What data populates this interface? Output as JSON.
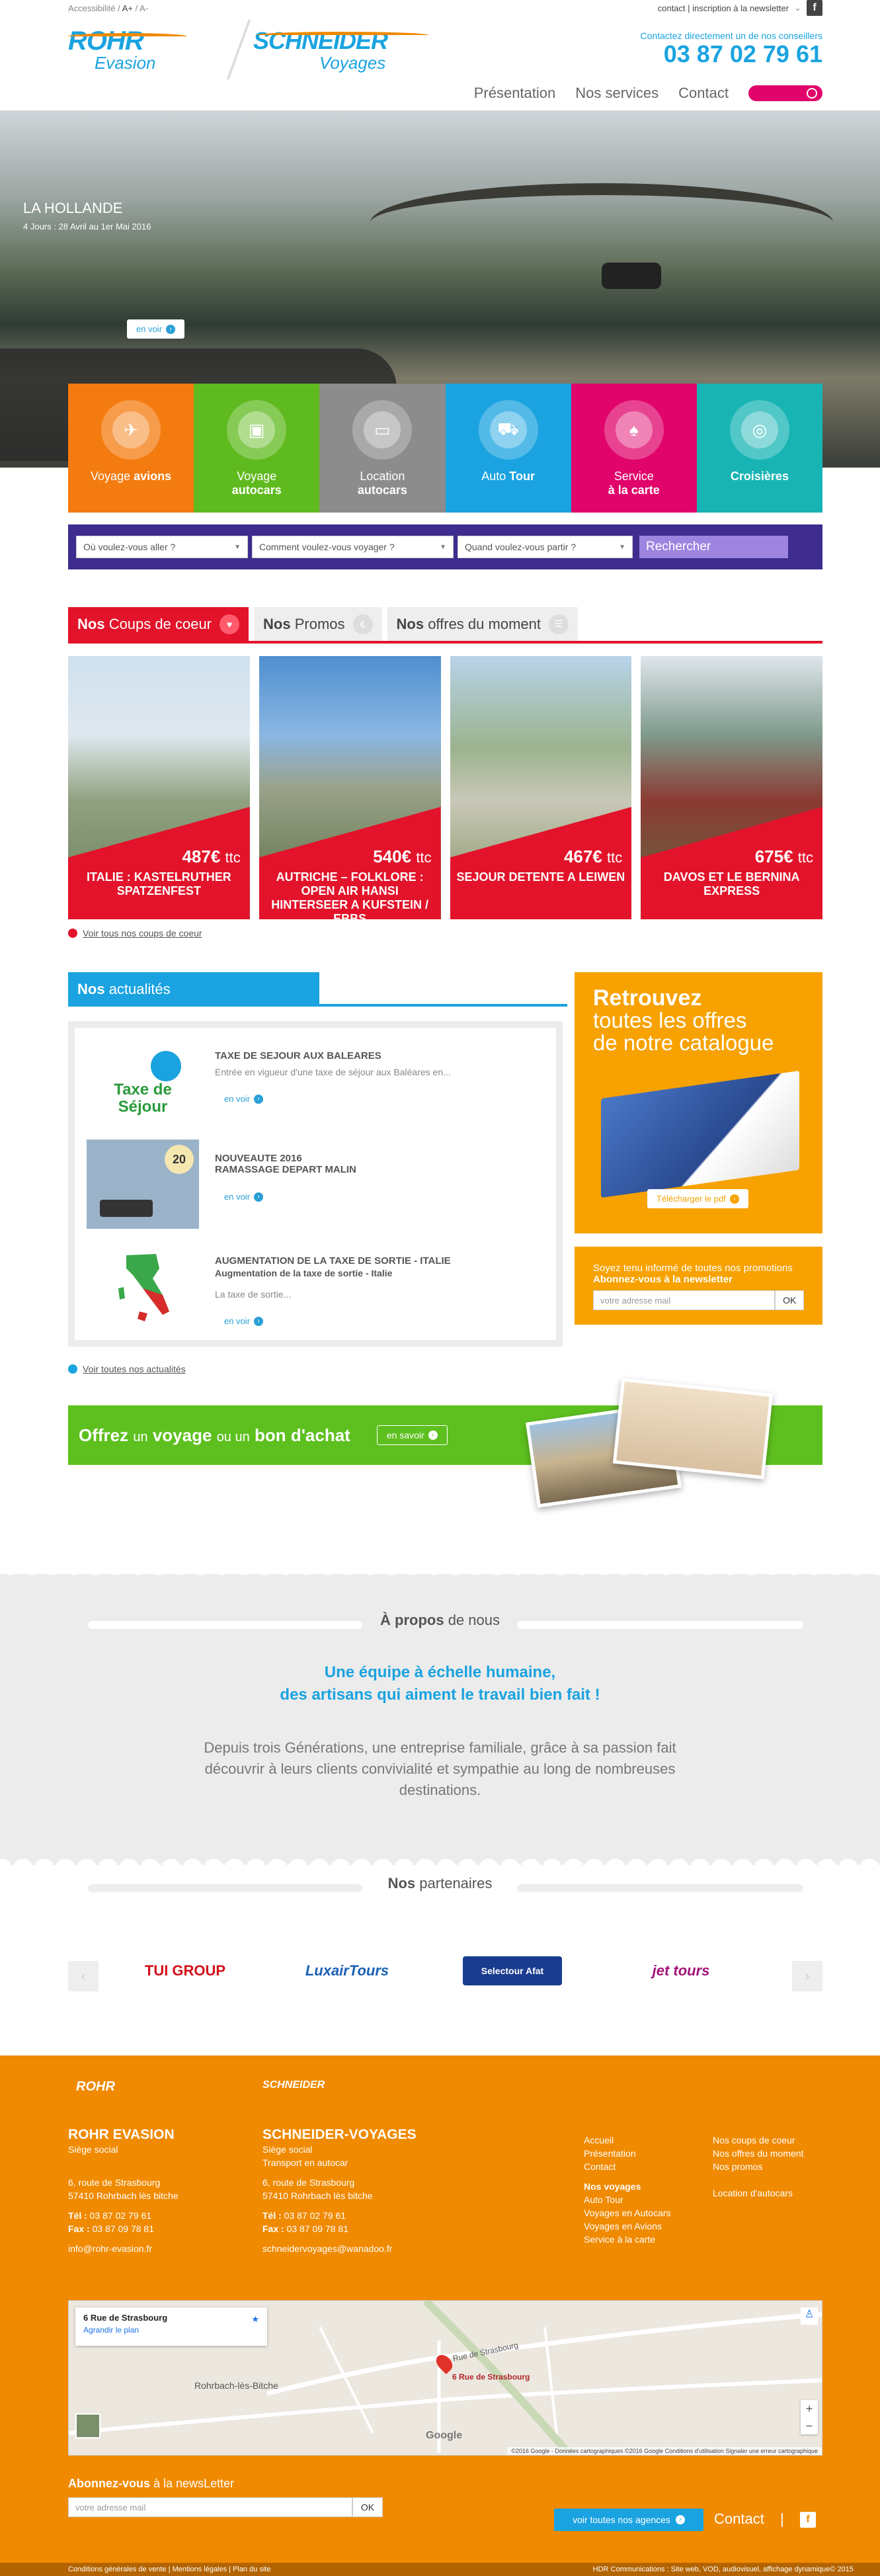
{
  "topbar": {
    "accessibility": "Accessibilité",
    "a_plus": "A+",
    "a_minus": "A-",
    "links": "contact | inscription à la newsletter",
    "facebook": "f"
  },
  "header": {
    "logo1_big": "ROHR",
    "logo1_small": "Evasion",
    "logo2_big": "SCHNEIDER",
    "logo2_small": "Voyages",
    "contact_line": "Contactez directement un de nos conseillers",
    "phone": "03 87 02 79 61"
  },
  "nav": {
    "items": [
      "Présentation",
      "Nos services",
      "Contact"
    ]
  },
  "hero": {
    "title": "LA HOLLANDE",
    "subtitle": "4 Jours : 28 Avril au 1er Mai 2016",
    "button": "en voir"
  },
  "tiles": [
    {
      "l1": "Voyage",
      "l2": "avions",
      "color": "#f47b0f",
      "icon": "plane-icon",
      "glyph": "✈"
    },
    {
      "l1": "Voyage",
      "l2": "autocars",
      "color": "#5fba1f",
      "icon": "bus-icon",
      "glyph": "🚌"
    },
    {
      "l1": "Location",
      "l2": "autocars",
      "color": "#8c8c8c",
      "icon": "coach-icon",
      "glyph": "🚍"
    },
    {
      "l1": "Auto",
      "l2": "Tour",
      "color": "#1aa3e0",
      "icon": "car-icon",
      "glyph": "🚗"
    },
    {
      "l1": "Service",
      "l2": "à la carte",
      "color": "#e0046b",
      "icon": "cards-icon",
      "glyph": "🂠"
    },
    {
      "l1": "",
      "l2": "Croisières",
      "color": "#18b4b4",
      "icon": "lifebuoy-icon",
      "glyph": "◎"
    }
  ],
  "search": {
    "where": "Où voulez-vous aller ?",
    "how": "Comment voulez-vous voyager ?",
    "when": "Quand voulez-vous partir ?",
    "button": "Rechercher"
  },
  "tabs": [
    {
      "b": "Nos",
      "t": "Coups de coeur",
      "ic": "♥"
    },
    {
      "b": "Nos",
      "t": "Promos",
      "ic": "€"
    },
    {
      "b": "Nos",
      "t": "offres du moment",
      "ic": "☰"
    }
  ],
  "offers": [
    {
      "price": "487€",
      "unit": "ttc",
      "name": "ITALIE : KASTELRUTHER SPATZENFEST"
    },
    {
      "price": "540€",
      "unit": "ttc",
      "name": "AUTRICHE – FOLKLORE : OPEN AIR HANSI HINTERSEER A KUFSTEIN / EBBS"
    },
    {
      "price": "467€",
      "unit": "ttc",
      "name": "SEJOUR DETENTE A LEIWEN"
    },
    {
      "price": "675€",
      "unit": "ttc",
      "name": "DAVOS ET LE BERNINA EXPRESS"
    }
  ],
  "offers_link": "Voir tous nos coups de coeur",
  "news": {
    "title_b": "Nos",
    "title": "actualités",
    "button": "en voir",
    "link": "Voir toutes nos actualités",
    "items": [
      {
        "title": "TAXE DE SEJOUR AUX BALEARES",
        "sub": "",
        "text": "Entrée en vigueur d'une taxe de séjour aux Baléares en...",
        "thumb": "Taxe de Séjour"
      },
      {
        "title": "NOUVEAUTE 2016 RAMASSAGE DEPART MALIN",
        "sub": "",
        "text": "",
        "thumb": "20"
      },
      {
        "title": "AUGMENTATION DE LA TAXE DE SORTIE - ITALIE",
        "sub": "Augmentation de la taxe de sortie - Italie",
        "text": "La taxe de sortie...",
        "thumb": ""
      }
    ]
  },
  "catalog": {
    "t1": "Retrouvez",
    "t2": "toutes les offres",
    "t3": "de notre catalogue",
    "button": "Télécharger le pdf"
  },
  "newsletter": {
    "l1": "Soyez tenu informé de toutes nos promotions",
    "l2": "Abonnez-vous à la newsletter",
    "placeholder": "votre adresse mail",
    "ok": "OK"
  },
  "gift": {
    "b1": "Offrez",
    "s1": "un",
    "b2": "voyage",
    "s2": "ou un",
    "b3": "bon d'achat",
    "button": "en savoir"
  },
  "about": {
    "title_b": "À propos",
    "title": "de nous",
    "tag1": "Une équipe à échelle humaine,",
    "tag2": "des artisans qui aiment le travail bien fait !",
    "desc": "Depuis trois Générations, une entreprise familiale, grâce à sa passion fait découvrir à leurs clients convivialité et sympathie au long de nombreuses destinations."
  },
  "partners": {
    "title_b": "Nos",
    "title": "partenaires",
    "items": [
      "TUI GROUP",
      "LuxairTours",
      "Selectour Afat",
      "jet tours"
    ]
  },
  "footer": {
    "rohr": {
      "logo": "ROHR",
      "name": "ROHR EVASION",
      "role": "Siège social",
      "addr1": "6, route de Strasbourg",
      "addr2": "57410 Rohrbach lès bitche",
      "tel_l": "Tél :",
      "tel": "03 87 02 79 61",
      "fax_l": "Fax :",
      "fax": "03 87 09 78 81",
      "mail": "info@rohr-evasion.fr"
    },
    "schneider": {
      "logo": "SCHNEIDER",
      "name": "SCHNEIDER-VOYAGES",
      "role": "Siège social",
      "role2": "Transport en autocar",
      "addr1": "6, route de Strasbourg",
      "addr2": "57410 Rohrbach lès bitche",
      "tel_l": "Tél :",
      "tel": "03 87 02 79 61",
      "fax_l": "Fax :",
      "fax": "03 87 09 78 81",
      "mail": "schneidervoyages@wanadoo.fr"
    },
    "links1": [
      "Accueil",
      "Présentation",
      "Contact"
    ],
    "voyages_title": "Nos voyages",
    "links2": [
      "Auto Tour",
      "Voyages en Autocars",
      "Voyages en Avions",
      "Service à la carte"
    ],
    "links3": [
      "Nos coups de coeur",
      "Nos offres du moment",
      "Nos promos"
    ],
    "links4": "Location d'autocars",
    "map": {
      "address": "6 Rue de Strasbourg",
      "enlarge": "Agrandir le plan",
      "pin": "6 Rue de Strasbourg",
      "road": "Rue de Strasbourg",
      "town": "Rohrbach-lès-Bitche",
      "credit": "©2016 Google - Données cartographiques ©2016 Google   Conditions d'utilisation   Signaler une erreur cartographique",
      "google": "Google"
    },
    "nl_b": "Abonnez-vous",
    "nl": "à la newsLetter",
    "nl_placeholder": "votre adresse mail",
    "nl_ok": "OK",
    "agencies": "voir toutes nos agences",
    "contact": "Contact",
    "bottom_left": "Conditions générales de vente  |  Mentions légales  |  Plan du site",
    "bottom_right": "HDR Communications : Site web, VOD, audiovisuel, affichage dynamique© 2015"
  }
}
